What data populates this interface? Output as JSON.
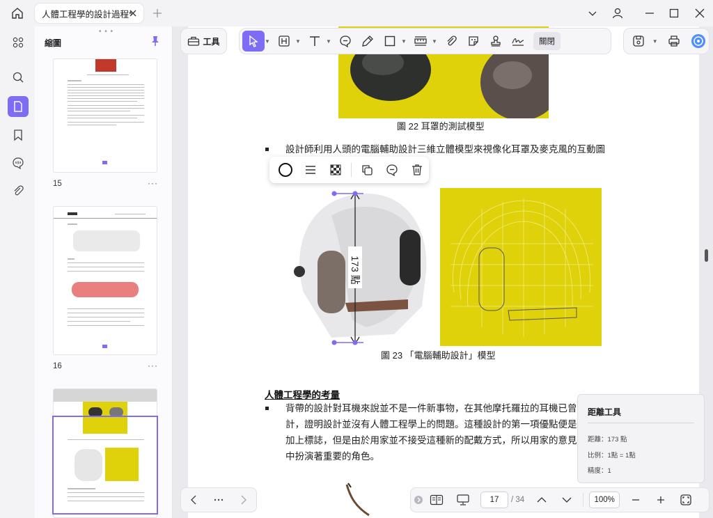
{
  "tab": {
    "title": "人體工程學的設計過程*"
  },
  "sidebar": {
    "title": "縮圖"
  },
  "thumbnails": [
    {
      "num": "15",
      "more": "···"
    },
    {
      "num": "16",
      "more": "···"
    }
  ],
  "toolbar": {
    "tools_label": "工具",
    "close_label": "關閉"
  },
  "document": {
    "caption22": "圖 22  耳罩的測試模型",
    "bullet1": "設計師利用人頭的電腦輔助設計三維立體模型來視像化耳罩及麥克風的互動圖",
    "measure_label": "173 點",
    "caption23": "圖 23  「電腦輔助設計」模型",
    "heading": "人體工程學的考量",
    "para_lines": [
      "背帶的設計對耳機來說並不是一件新事物，在其他摩托羅拉的耳機已曾",
      "計，證明設計並沒有人體工程學上的問題。這種設計的第一項優點便是",
      "加上標誌，但是由於用家並不接受這種新的配戴方式，所以用家的意見",
      "中扮演著重要的角色。"
    ]
  },
  "distance_tool": {
    "title": "距離工具",
    "distance": "距離：173 點",
    "scale": "比例：1點 = 1點",
    "precision": "精度：1"
  },
  "pager": {
    "current": "17",
    "total": "/ 34",
    "zoom": "100%"
  },
  "colors": {
    "accent": "#7d6cf4",
    "yellow": "#dfd20a"
  }
}
